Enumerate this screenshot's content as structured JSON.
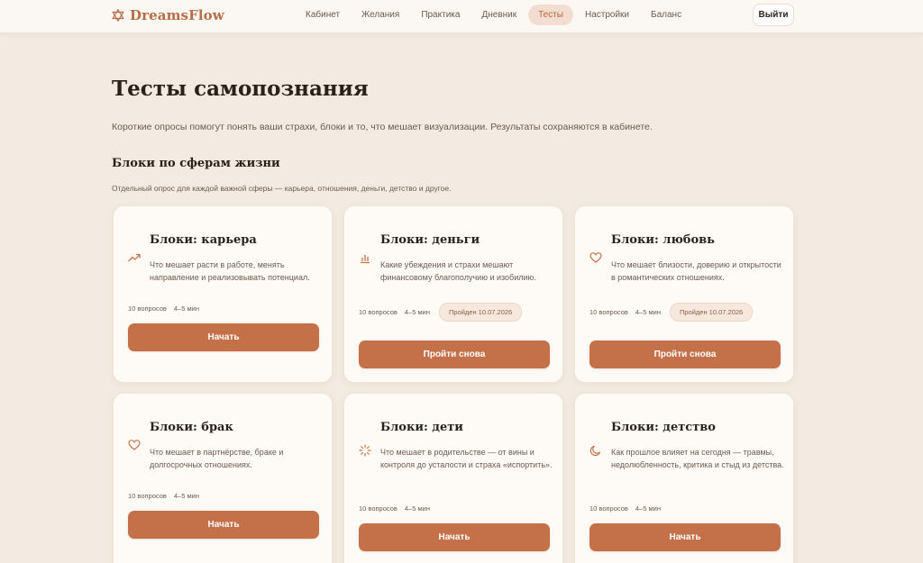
{
  "header": {
    "logo_text": "DreamsFlow",
    "logo_icon": "star-of-david-icon",
    "nav": [
      {
        "label": "Кабинет",
        "active": false
      },
      {
        "label": "Желания",
        "active": false
      },
      {
        "label": "Практика",
        "active": false
      },
      {
        "label": "Дневник",
        "active": false
      },
      {
        "label": "Тесты",
        "active": true
      },
      {
        "label": "Настройки",
        "active": false
      },
      {
        "label": "Баланс",
        "active": false
      }
    ],
    "logout_label": "Выйти"
  },
  "page": {
    "title": "Тесты самопознания",
    "subtitle": "Короткие опросы помогут понять ваши страхи, блоки и то, что мешает визуализации. Результаты сохраняются в кабинете."
  },
  "section": {
    "title": "Блоки по сферам жизни",
    "description": "Отдельный опрос для каждой важной сферы — карьера, отношения, деньги, детство и другое."
  },
  "colors": {
    "accent": "#c4714a",
    "background": "#f3ebe1",
    "card": "#fefbf7",
    "nav_active": "#f3ddd0"
  },
  "cards": [
    {
      "title": "Блоки: карьера",
      "icon": "trending-up-icon",
      "description": "Что мешает расти в работе, менять направление и реализовывать потенциал.",
      "questions": "10 вопросов",
      "duration": "4–5 мин",
      "badge": "",
      "button": "Начать"
    },
    {
      "title": "Блоки: деньги",
      "icon": "bar-chart-icon",
      "description": "Какие убеждения и страхи мешают финансовому благополучию и изобилию.",
      "questions": "10 вопросов",
      "duration": "4–5 мин",
      "badge": "Пройден 10.07.2026",
      "button": "Пройти снова"
    },
    {
      "title": "Блоки: любовь",
      "icon": "heart-icon",
      "description": "Что мешает близости, доверию и открытости в романтических отношениях.",
      "questions": "10 вопросов",
      "duration": "4–5 мин",
      "badge": "Пройден 10.07.2026",
      "button": "Пройти снова"
    },
    {
      "title": "Блоки: брак",
      "icon": "heart-icon",
      "description": "Что мешает в партнёрстве, браке и долгосрочных отношениях.",
      "questions": "10 вопросов",
      "duration": "4–5 мин",
      "badge": "",
      "button": "Начать"
    },
    {
      "title": "Блоки: дети",
      "icon": "loader-icon",
      "description": "Что мешает в родительстве — от вины и контроля до усталости и страха «испортить».",
      "questions": "10 вопросов",
      "duration": "4–5 мин",
      "badge": "",
      "button": "Начать"
    },
    {
      "title": "Блоки: детство",
      "icon": "moon-icon",
      "description": "Как прошлое влияет на сегодня — травмы, недолюбленность, критика и стыд из детства.",
      "questions": "10 вопросов",
      "duration": "4–5 мин",
      "badge": "",
      "button": "Начать"
    }
  ]
}
